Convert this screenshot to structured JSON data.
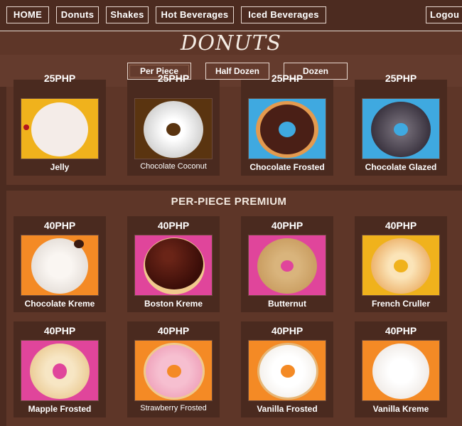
{
  "nav": {
    "home": "HOME",
    "donuts": "Donuts",
    "shakes": "Shakes",
    "hot": "Hot Beverages",
    "iced": "Iced Beverages",
    "logout": "Logou"
  },
  "page_title": "DONUTS",
  "subnav": {
    "per_piece": "Per Piece",
    "half_dozen": "Half Dozen",
    "dozen": "Dozen"
  },
  "section_regular": {
    "price_partial": "25PHP",
    "items": [
      {
        "name": "Jelly",
        "bg": "#f0b21c",
        "icon": "jelly-donut"
      },
      {
        "name": "Chocolate Coconut",
        "bg": "#5a3410",
        "icon": "chocolate-coconut-donut"
      },
      {
        "name": "Chocolate Frosted",
        "bg": "#3fa9e0",
        "icon": "chocolate-frosted-donut"
      },
      {
        "name": "Chocolate Glazed",
        "bg": "#3fa9e0",
        "icon": "chocolate-glazed-donut"
      }
    ]
  },
  "section_premium": {
    "title": "PER-PIECE PREMIUM",
    "items": [
      {
        "price": "40PHP",
        "name": "Chocolate Kreme",
        "bg": "#f48a25",
        "icon": "chocolate-kreme-donut"
      },
      {
        "price": "40PHP",
        "name": "Boston Kreme",
        "bg": "#e0459b",
        "icon": "boston-kreme-donut"
      },
      {
        "price": "40PHP",
        "name": "Butternut",
        "bg": "#e0459b",
        "icon": "butternut-donut"
      },
      {
        "price": "40PHP",
        "name": "French Cruller",
        "bg": "#f0b21c",
        "icon": "french-cruller-donut"
      },
      {
        "price": "40PHP",
        "name": "Mapple Frosted",
        "bg": "#e0459b",
        "icon": "mapple-frosted-donut"
      },
      {
        "price": "40PHP",
        "name": "Strawberry Frosted",
        "bg": "#f48a25",
        "icon": "strawberry-frosted-donut"
      },
      {
        "price": "40PHP",
        "name": "Vanilla Frosted",
        "bg": "#f48a25",
        "icon": "vanilla-frosted-donut"
      },
      {
        "price": "40PHP",
        "name": "Vanilla Kreme",
        "bg": "#f48a25",
        "icon": "vanilla-kreme-donut"
      }
    ]
  }
}
